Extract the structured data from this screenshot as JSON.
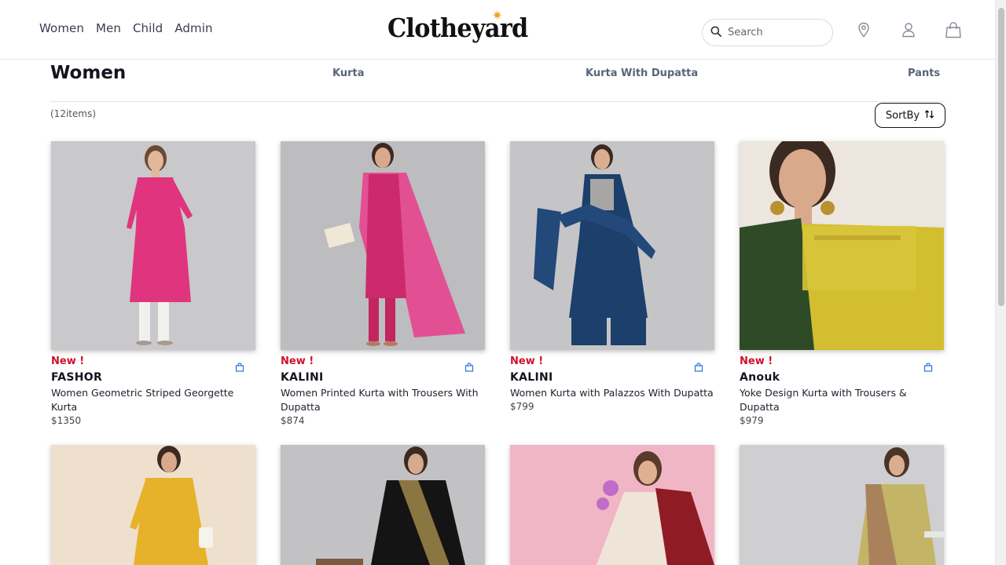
{
  "header": {
    "nav": [
      "Women",
      "Men",
      "Child",
      "Admin"
    ],
    "logo": "Clotheyard",
    "search_placeholder": "Search"
  },
  "category": {
    "title": "Women",
    "subcategories": [
      "Kurta",
      "Kurta With Dupatta",
      "Pants"
    ],
    "item_count": "(12items)",
    "sort_label": "SortBy"
  },
  "colors": {
    "accent_new": "#d0102e",
    "logo_star": "#f0a11a"
  },
  "products": [
    {
      "badge": "New !",
      "brand": "FASHOR",
      "name": "Women Geometric Striped Georgette Kurta",
      "price": "$1350"
    },
    {
      "badge": "New !",
      "brand": "KALINI",
      "name": "Women Printed Kurta with Trousers With Dupatta",
      "price": "$874"
    },
    {
      "badge": "New !",
      "brand": "KALINI",
      "name": "Women Kurta with Palazzos With Dupatta",
      "price": "$799"
    },
    {
      "badge": "New !",
      "brand": "Anouk",
      "name": "Yoke Design Kurta with Trousers & Dupatta",
      "price": "$979"
    }
  ]
}
